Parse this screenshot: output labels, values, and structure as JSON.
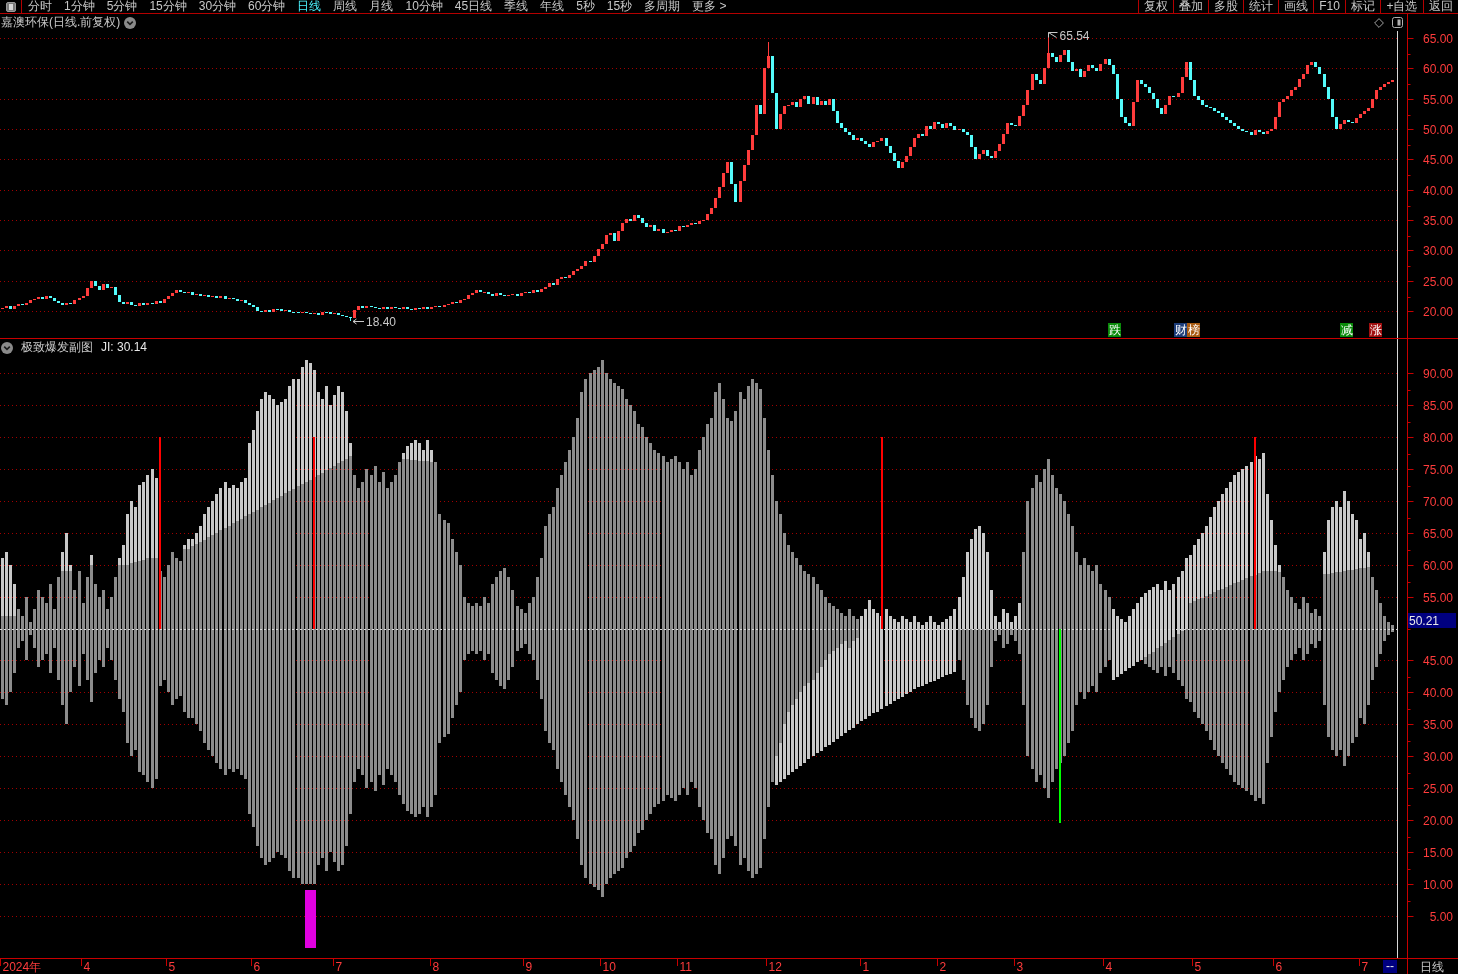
{
  "toolbar": {
    "period_tabs": [
      {
        "label": "分时",
        "selected": false
      },
      {
        "label": "1分钟",
        "selected": false
      },
      {
        "label": "5分钟",
        "selected": false
      },
      {
        "label": "15分钟",
        "selected": false
      },
      {
        "label": "30分钟",
        "selected": false
      },
      {
        "label": "60分钟",
        "selected": false
      },
      {
        "label": "日线",
        "selected": true
      },
      {
        "label": "周线",
        "selected": false
      },
      {
        "label": "月线",
        "selected": false
      },
      {
        "label": "10分钟",
        "selected": false
      },
      {
        "label": "45日线",
        "selected": false
      },
      {
        "label": "季线",
        "selected": false
      },
      {
        "label": "年线",
        "selected": false
      },
      {
        "label": "5秒",
        "selected": false
      },
      {
        "label": "15秒",
        "selected": false
      },
      {
        "label": "多周期",
        "selected": false
      },
      {
        "label": "更多 >",
        "selected": false
      }
    ],
    "buttons": [
      "复权",
      "叠加",
      "多股",
      "统计",
      "画线",
      "F10",
      "标记",
      "+自选",
      "返回"
    ]
  },
  "price_panel": {
    "title": "嘉澳环保(日线.前复权)",
    "high_label": "65.54",
    "low_label": "18.40",
    "event_markers": [
      {
        "label": "跌",
        "color": "#0a8a0a"
      },
      {
        "label": "财",
        "color": "#1c3c78"
      },
      {
        "label": "榜",
        "color": "#a85a10"
      },
      {
        "label": "减",
        "color": "#0a8a0a"
      },
      {
        "label": "涨",
        "color": "#a01010"
      }
    ],
    "axis_labels": [
      "65.00",
      "60.00",
      "55.00",
      "50.00",
      "45.00",
      "40.00",
      "35.00",
      "30.00",
      "25.00",
      "20.00"
    ]
  },
  "indicator_panel": {
    "name": "极致爆发副图",
    "value": "JI: 30.14",
    "cursor_value": "50.21",
    "axis_labels": [
      "90.00",
      "85.00",
      "80.00",
      "75.00",
      "70.00",
      "65.00",
      "60.00",
      "55.00",
      "45.00",
      "40.00",
      "35.00",
      "30.00",
      "25.00",
      "20.00",
      "15.00",
      "10.00",
      "5.00"
    ]
  },
  "date_axis": {
    "labels": [
      "2024年",
      "4",
      "5",
      "6",
      "7",
      "8",
      "9",
      "10",
      "11",
      "12",
      "1",
      "2",
      "3",
      "4",
      "5",
      "6",
      "7"
    ],
    "cursor_date": "--",
    "period": "日线"
  }
}
